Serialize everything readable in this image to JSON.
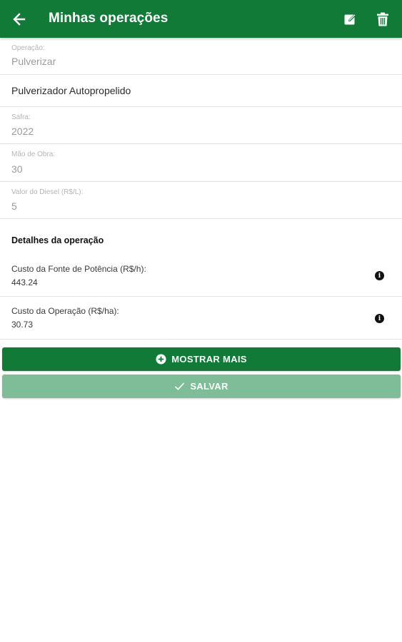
{
  "header": {
    "title": "Minhas operações",
    "back_icon": "arrow-left-icon",
    "edit_icon": "edit-square-icon",
    "delete_icon": "trash-icon",
    "color": "#107a36"
  },
  "fields": {
    "operacao": {
      "label": "Operação:",
      "value": "Pulverizar"
    },
    "equipamento": {
      "value": "Pulverizador Autopropelido"
    },
    "safra": {
      "label": "Safra:",
      "value": "2022"
    },
    "mao_de_obra": {
      "label": "Mão de Obra:",
      "value": "30"
    },
    "valor_diesel": {
      "label": "Valor do Diesel (R$/L):",
      "value": "5"
    }
  },
  "details": {
    "title": "Detalhes da operação",
    "items": [
      {
        "label": "Custo da Fonte de Potência (R$/h):",
        "value": "443.24",
        "icon": "info-icon"
      },
      {
        "label": "Custo da Operação (R$/ha):",
        "value": "30.73",
        "icon": "info-icon"
      }
    ]
  },
  "buttons": {
    "more_label": "MOSTRAR MAIS",
    "more_icon": "plus-circle-icon",
    "save_label": "SALVAR",
    "save_icon": "check-icon",
    "save_color": "#7fbd99"
  }
}
